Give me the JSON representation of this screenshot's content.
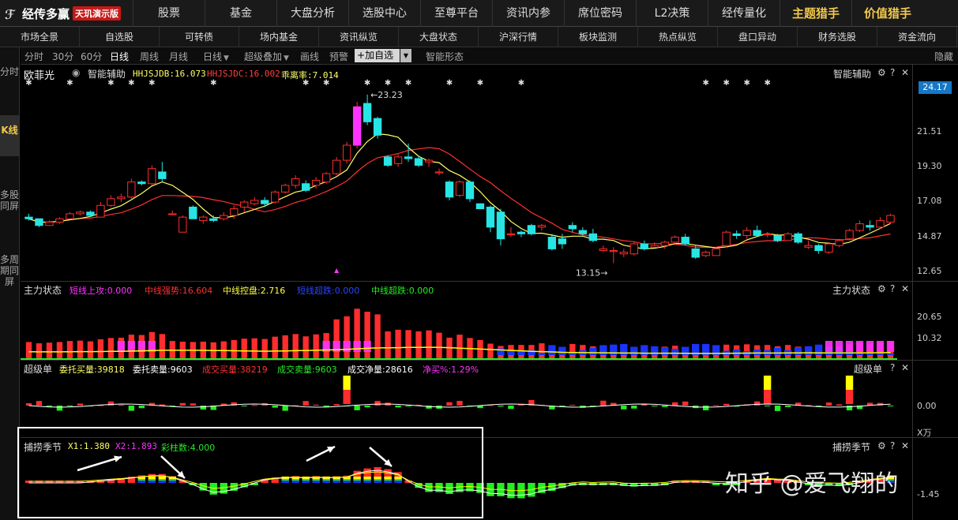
{
  "app": {
    "name": "经传多赢",
    "badge": "天玑演示版"
  },
  "topnav": [
    "股票",
    "基金",
    "大盘分析",
    "选股中心",
    "至尊平台",
    "资讯内参",
    "席位密码",
    "L2决策",
    "经传量化",
    "主题猎手",
    "价值猎手"
  ],
  "subnav": [
    "市场全景",
    "自选股",
    "可转债",
    "场内基金",
    "资讯纵览",
    "大盘状态",
    "沪深行情",
    "板块监测",
    "热点纵览",
    "盘口异动",
    "财务选股",
    "资金流向"
  ],
  "timeframes": [
    "分时",
    "30分",
    "60分",
    "日线",
    "周线",
    "月线"
  ],
  "active_timeframe": "日线",
  "tools": {
    "period": "日线",
    "overlay": "超级叠加",
    "draw": "画线",
    "alert": "预警",
    "add": "加自选",
    "smart": "智能形态",
    "hide": "隐藏"
  },
  "leftbar": [
    "分时",
    "K线",
    "多股同屏",
    "多周期同屏"
  ],
  "main": {
    "stock": "欧菲光",
    "assist": "智能辅助",
    "ind1": "HHJSJDB:16.073",
    "ind2": "HHJSJDC:16.002",
    "ind3": "乖离率:7.014",
    "price_tag": "24.17",
    "y_labels": [
      "21.51",
      "19.30",
      "17.08",
      "14.87",
      "12.65"
    ],
    "high_label": "23.23",
    "low_label": "13.15",
    "title_right": "智能辅助",
    "marker": "✱"
  },
  "panel2": {
    "title": "主力状态",
    "i1": "短线上攻:0.000",
    "i2": "中线强势:16.604",
    "i3": "中线控盘:2.716",
    "i4": "短线超跌:0.000",
    "i5": "中线超跌:0.000",
    "y_labels": [
      "20.65",
      "10.32"
    ]
  },
  "panel3": {
    "title": "超级单",
    "i1": "委托买量:39818",
    "i2": "委托卖量:9603",
    "i3": "成交买量:38219",
    "i4": "成交卖量:9603",
    "i5": "成交净量:28616",
    "i6": "净买%:1.29%",
    "y_label": "0.00",
    "unit": "X万"
  },
  "panel4": {
    "title": "捕捞季节",
    "i1": "X1:1.380",
    "i2": "X2:1.893",
    "i3": "彩柱数:4.000",
    "y_label": "-1.45"
  },
  "controls": {
    "gear": "⚙",
    "help": "?",
    "close": "✕"
  },
  "watermark": "知乎 @爱飞翔的",
  "colors": {
    "up": "#ff2d2d",
    "down": "#27e5e5",
    "ma5": "#ffff66",
    "ma10": "#ff3030",
    "magenta": "#ff33ff",
    "green": "#22ee22",
    "yellow": "#ffff00",
    "blue": "#1a34ff"
  },
  "chart_data": {
    "type": "candlestick",
    "ylim": [
      12.65,
      24.17
    ],
    "candles": [
      [
        15.9,
        16.1,
        15.7,
        15.8
      ],
      [
        15.8,
        15.8,
        15.3,
        15.4
      ],
      [
        15.4,
        15.7,
        15.4,
        15.6
      ],
      [
        15.6,
        15.9,
        15.5,
        15.8
      ],
      [
        15.8,
        16.2,
        15.8,
        16.1
      ],
      [
        16.1,
        16.3,
        16.0,
        16.2
      ],
      [
        16.2,
        16.3,
        15.9,
        16.0
      ],
      [
        15.9,
        16.8,
        15.9,
        16.6
      ],
      [
        16.6,
        17.2,
        16.5,
        17.0
      ],
      [
        17.0,
        17.3,
        16.8,
        17.1
      ],
      [
        17.1,
        18.2,
        17.0,
        18.0
      ],
      [
        18.0,
        18.1,
        17.8,
        17.9
      ],
      [
        17.9,
        19.0,
        17.8,
        18.8
      ],
      [
        18.6,
        19.2,
        18.0,
        18.2
      ],
      [
        16.1,
        16.3,
        16.0,
        16.1
      ],
      [
        15.0,
        16.0,
        15.0,
        15.9
      ],
      [
        16.5,
        16.6,
        15.8,
        15.8
      ],
      [
        15.7,
        16.0,
        15.5,
        15.9
      ],
      [
        15.8,
        16.0,
        15.6,
        15.7
      ],
      [
        15.8,
        16.2,
        15.7,
        16.0
      ],
      [
        16.0,
        16.6,
        15.8,
        16.4
      ],
      [
        16.5,
        16.9,
        16.2,
        16.8
      ],
      [
        16.7,
        17.1,
        16.6,
        16.9
      ],
      [
        16.9,
        17.1,
        16.5,
        16.7
      ],
      [
        16.8,
        17.5,
        16.7,
        17.4
      ],
      [
        17.4,
        17.9,
        17.3,
        17.8
      ],
      [
        17.8,
        18.4,
        17.6,
        18.2
      ],
      [
        17.9,
        18.1,
        17.4,
        17.5
      ],
      [
        17.8,
        18.3,
        17.6,
        18.1
      ],
      [
        18.0,
        18.6,
        17.9,
        18.5
      ],
      [
        18.5,
        19.5,
        18.4,
        19.3
      ],
      [
        19.3,
        20.4,
        19.1,
        20.2
      ],
      [
        20.2,
        22.8,
        20.0,
        22.5
      ],
      [
        22.7,
        23.23,
        21.4,
        21.6
      ],
      [
        21.8,
        21.9,
        20.6,
        20.8
      ],
      [
        19.5,
        19.6,
        18.9,
        19.0
      ],
      [
        19.1,
        19.7,
        18.9,
        19.5
      ],
      [
        19.5,
        20.3,
        19.2,
        19.4
      ],
      [
        19.4,
        19.6,
        18.9,
        19.0
      ],
      [
        19.2,
        19.4,
        18.9,
        19.3
      ],
      [
        18.6,
        18.8,
        18.4,
        18.6
      ],
      [
        18.0,
        18.1,
        16.9,
        17.1
      ],
      [
        17.2,
        18.1,
        17.1,
        18.0
      ],
      [
        18.0,
        18.1,
        16.8,
        17.0
      ],
      [
        16.7,
        16.7,
        16.4,
        16.4
      ],
      [
        16.5,
        16.6,
        15.0,
        15.3
      ],
      [
        16.2,
        16.4,
        14.2,
        14.6
      ],
      [
        14.9,
        15.3,
        14.7,
        14.9
      ],
      [
        15.0,
        15.1,
        14.7,
        14.9
      ],
      [
        15.4,
        15.5,
        14.8,
        14.9
      ],
      [
        15.3,
        15.5,
        15.1,
        15.4
      ],
      [
        14.7,
        14.9,
        13.9,
        14.0
      ],
      [
        14.6,
        14.9,
        14.0,
        14.3
      ],
      [
        15.4,
        15.6,
        15.0,
        15.2
      ],
      [
        15.1,
        15.3,
        14.8,
        14.9
      ],
      [
        14.9,
        15.2,
        14.4,
        14.5
      ],
      [
        13.9,
        14.2,
        13.8,
        14.0
      ],
      [
        13.9,
        14.1,
        13.15,
        13.9
      ],
      [
        13.7,
        14.0,
        13.5,
        13.8
      ],
      [
        13.7,
        14.4,
        13.6,
        14.3
      ],
      [
        14.3,
        14.5,
        13.9,
        14.0
      ],
      [
        14.1,
        14.4,
        14.1,
        14.2
      ],
      [
        14.2,
        14.5,
        14.0,
        14.4
      ],
      [
        14.4,
        14.8,
        14.3,
        14.7
      ],
      [
        14.7,
        14.9,
        14.2,
        14.3
      ],
      [
        14.0,
        14.2,
        13.4,
        13.5
      ],
      [
        13.6,
        13.9,
        13.5,
        13.8
      ],
      [
        13.6,
        14.1,
        13.6,
        14.0
      ],
      [
        14.2,
        15.1,
        14.1,
        15.0
      ],
      [
        14.9,
        15.1,
        14.6,
        14.8
      ],
      [
        14.8,
        15.3,
        14.6,
        15.1
      ],
      [
        15.1,
        15.4,
        14.7,
        14.8
      ],
      [
        14.9,
        15.0,
        14.7,
        14.9
      ],
      [
        14.8,
        14.9,
        14.4,
        14.5
      ],
      [
        14.5,
        15.0,
        14.5,
        14.9
      ],
      [
        14.9,
        15.0,
        14.3,
        14.4
      ],
      [
        14.1,
        14.5,
        14.0,
        14.2
      ],
      [
        14.2,
        14.3,
        13.7,
        13.9
      ],
      [
        13.8,
        14.4,
        13.7,
        14.3
      ],
      [
        14.2,
        14.6,
        14.1,
        14.5
      ],
      [
        14.6,
        15.2,
        14.5,
        15.1
      ],
      [
        15.1,
        15.7,
        15.0,
        15.5
      ],
      [
        15.4,
        15.7,
        15.1,
        15.3
      ],
      [
        15.3,
        15.9,
        15.2,
        15.7
      ],
      [
        15.6,
        16.1,
        15.5,
        16.0
      ]
    ]
  }
}
